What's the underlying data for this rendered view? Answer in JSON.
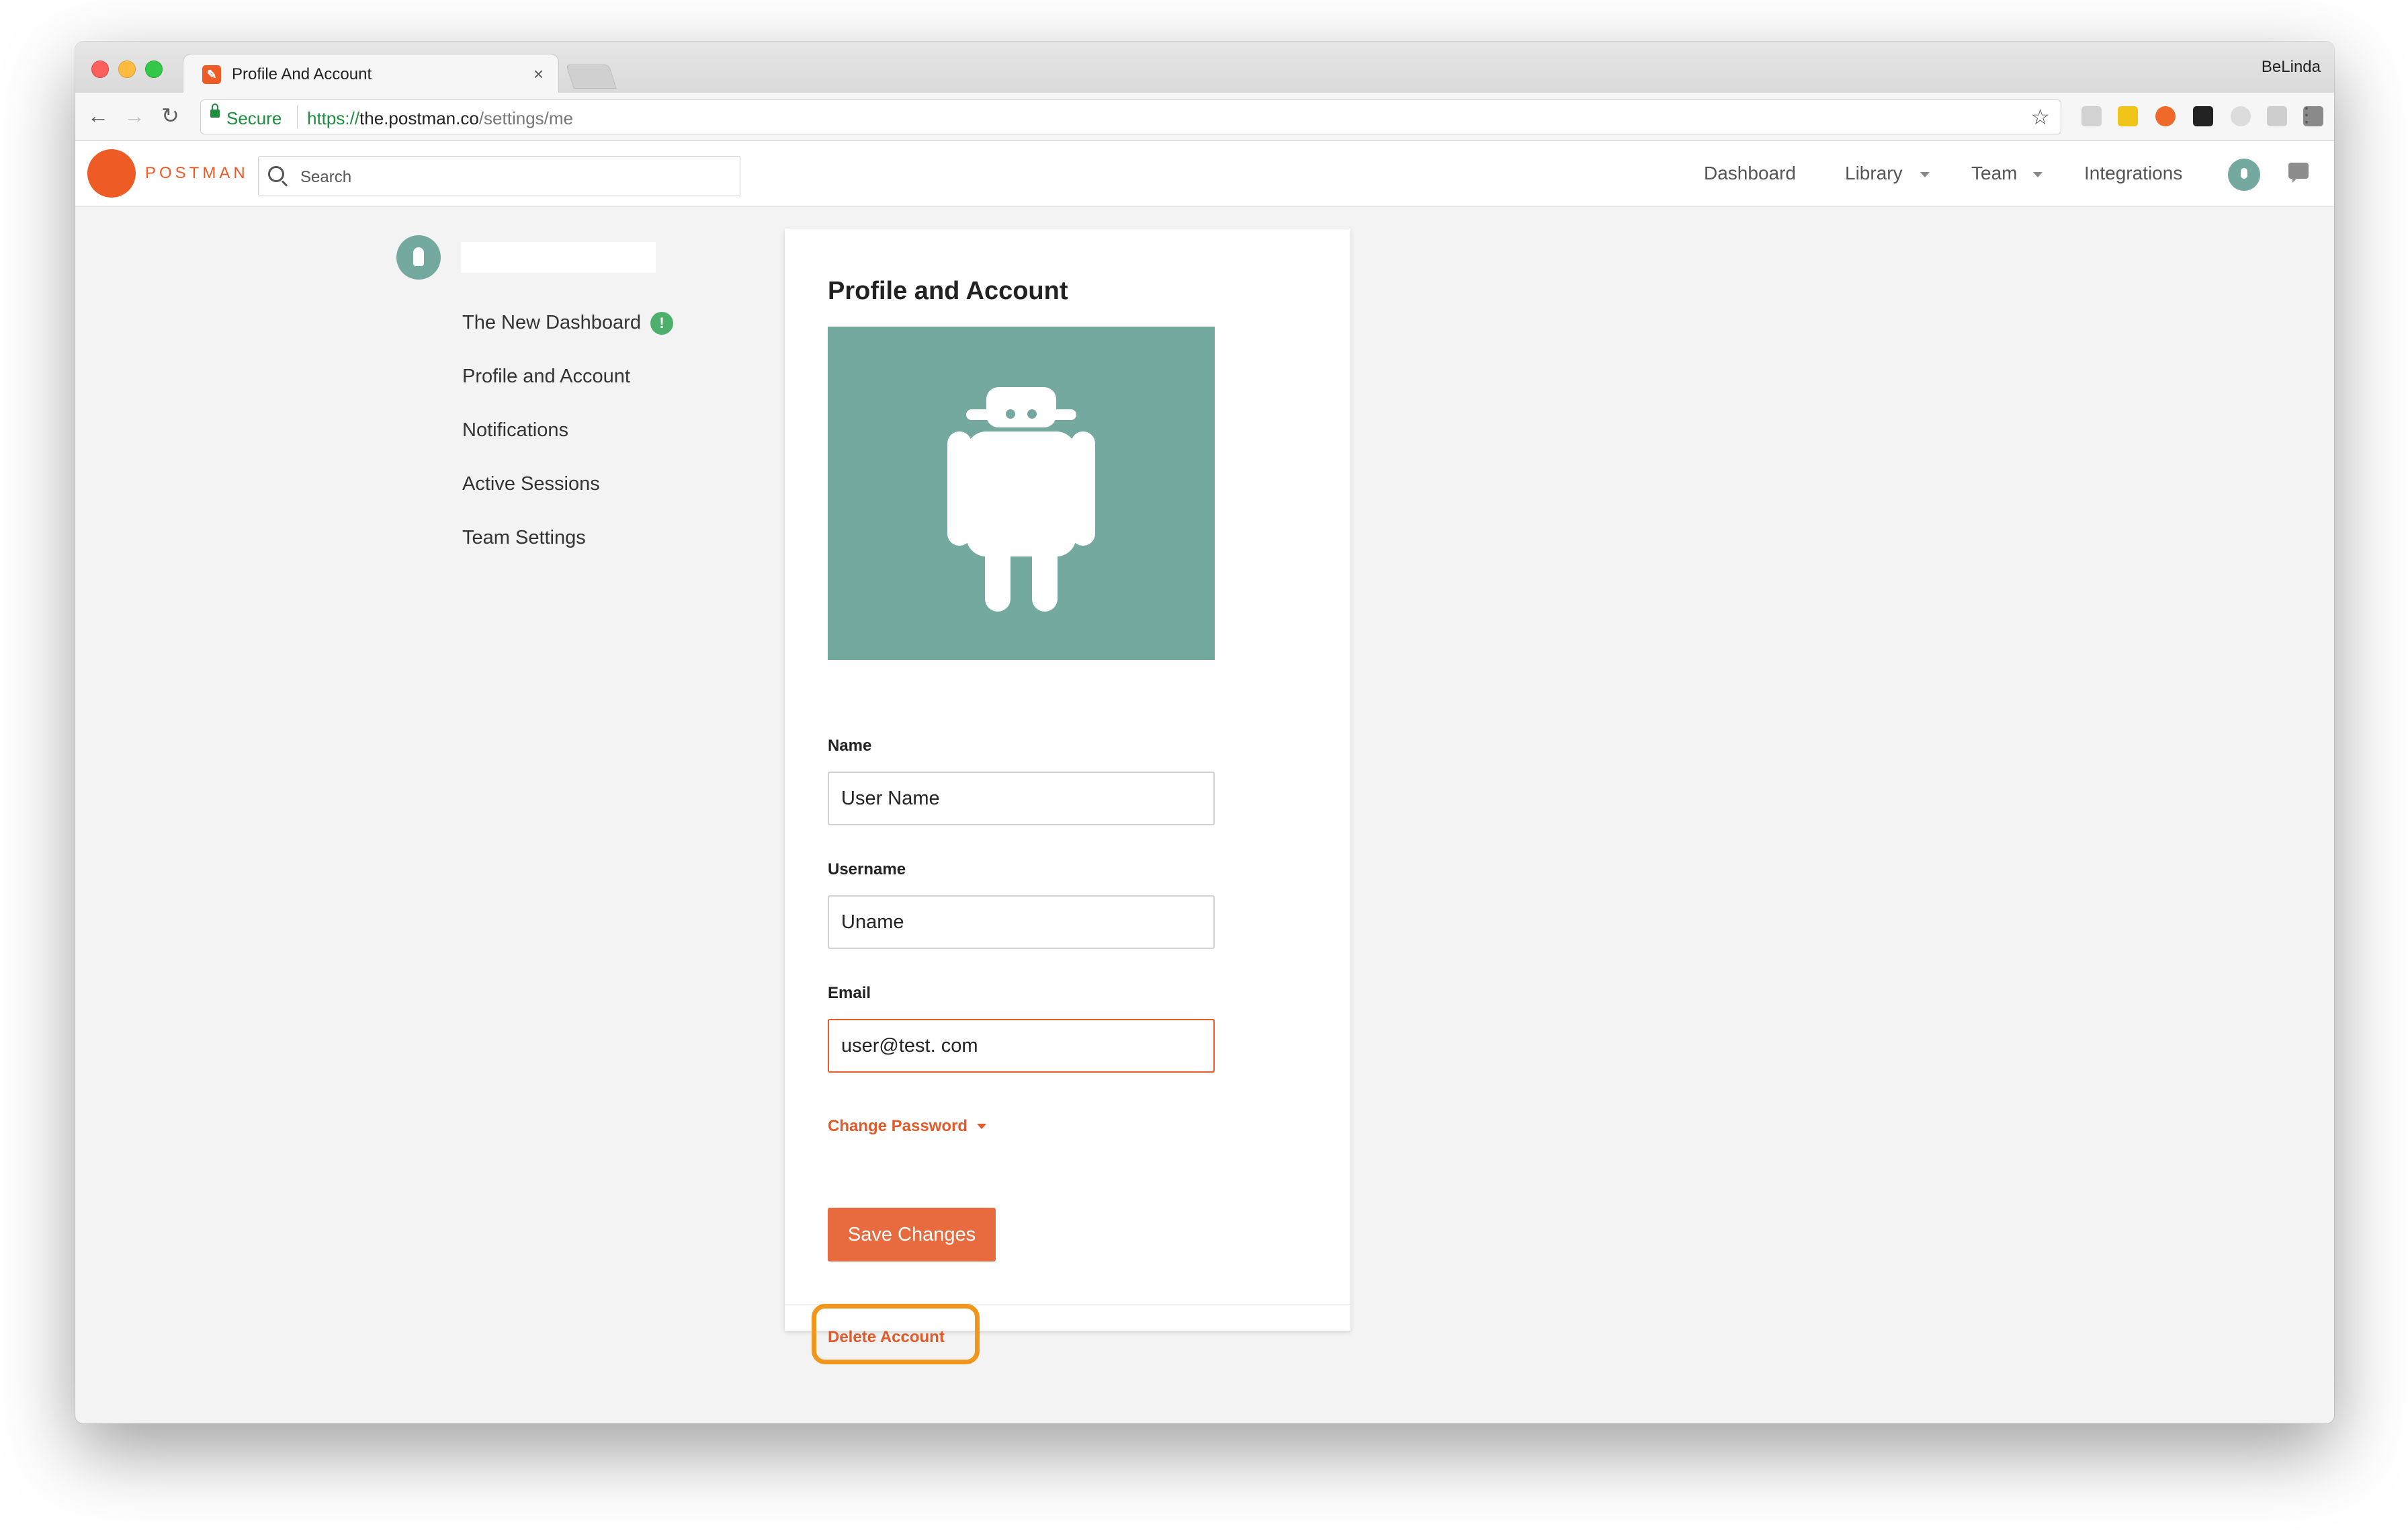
{
  "browser": {
    "tab_title": "Profile And Account",
    "profile_name": "BeLinda",
    "security_label": "Secure",
    "url_scheme": "https://",
    "url_host": "the.postman.co",
    "url_path": "/settings/me"
  },
  "app": {
    "brand": "POSTMAN",
    "search_placeholder": "Search",
    "nav": {
      "dashboard": "Dashboard",
      "library": "Library",
      "team": "Team",
      "integrations": "Integrations"
    }
  },
  "sidebar": {
    "items": [
      {
        "label": "The New Dashboard"
      },
      {
        "label": "Profile and Account"
      },
      {
        "label": "Notifications"
      },
      {
        "label": "Active Sessions"
      },
      {
        "label": "Team Settings"
      }
    ],
    "badge_glyph": "!"
  },
  "profile": {
    "title": "Profile and Account",
    "name_label": "Name",
    "name_value": "User Name",
    "username_label": "Username",
    "username_value": "Uname",
    "email_label": "Email",
    "email_value": "user@test. com",
    "change_password": "Change Password",
    "save_button": "Save Changes",
    "delete_account": "Delete Account"
  },
  "colors": {
    "brand": "#ef5b25",
    "avatar_bg": "#74a9a0",
    "highlight": "#f1961c"
  }
}
